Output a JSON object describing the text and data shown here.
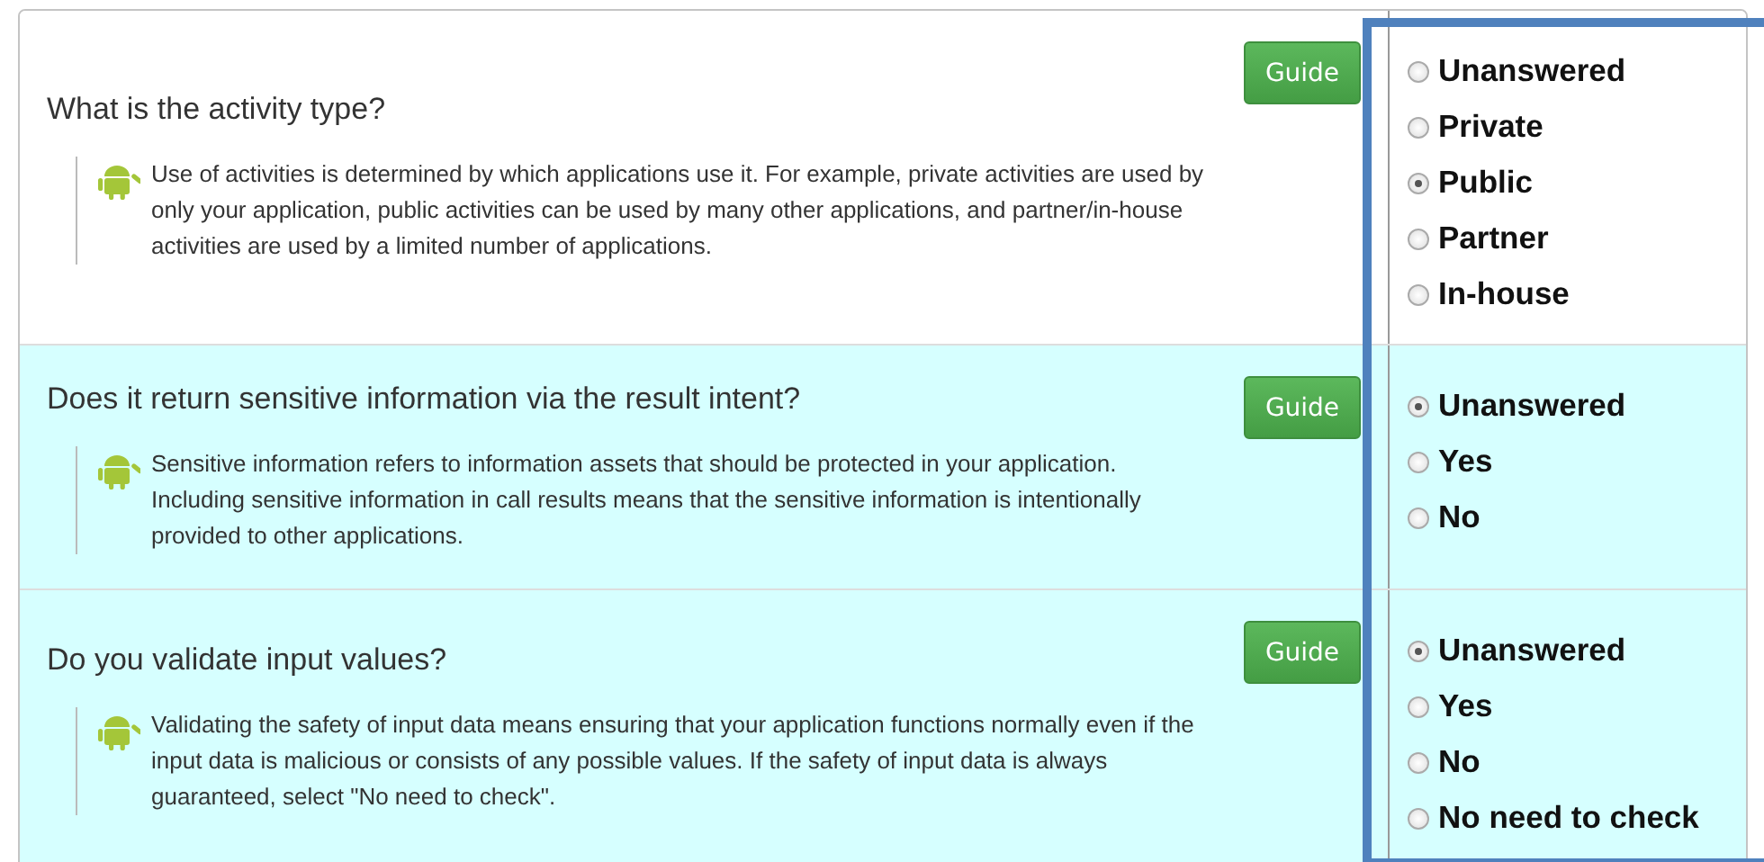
{
  "questions": [
    {
      "question": "What is the activity type?",
      "description": "Use of activities is determined by which applications use it. For example, private activities are used by only your application, public activities can be used by many other applications, and partner/in-house activities are used by a limited number of applications.",
      "guide": "Guide",
      "highlighted": false,
      "options": [
        {
          "label": "Unanswered",
          "selected": false
        },
        {
          "label": "Private",
          "selected": false
        },
        {
          "label": "Public",
          "selected": true
        },
        {
          "label": "Partner",
          "selected": false
        },
        {
          "label": "In-house",
          "selected": false
        }
      ]
    },
    {
      "question": "Does it return sensitive information via the result intent?",
      "description": "Sensitive information refers to information assets that should be protected in your application. Including sensitive information in call results means that the sensitive information is intentionally provided to other applications.",
      "guide": "Guide",
      "highlighted": true,
      "options": [
        {
          "label": "Unanswered",
          "selected": true
        },
        {
          "label": "Yes",
          "selected": false
        },
        {
          "label": "No",
          "selected": false
        }
      ]
    },
    {
      "question": "Do you validate input values?",
      "description": "Validating the safety of input data means ensuring that your application functions normally even if the input data is malicious or consists of any possible values. If the safety of input data is always guaranteed, select \"No need to check\".",
      "guide": "Guide",
      "highlighted": true,
      "options": [
        {
          "label": "Unanswered",
          "selected": true
        },
        {
          "label": "Yes",
          "selected": false
        },
        {
          "label": "No",
          "selected": false
        },
        {
          "label": "No need to check",
          "selected": false
        }
      ]
    }
  ]
}
